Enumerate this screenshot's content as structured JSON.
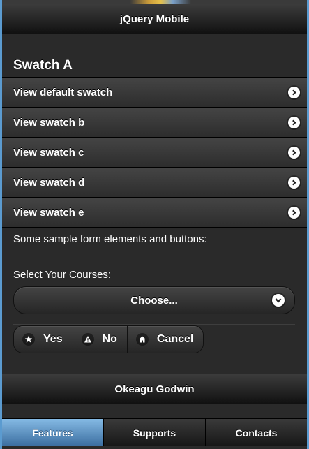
{
  "header": {
    "title": "jQuery Mobile"
  },
  "content": {
    "swatch_title": "Swatch A",
    "list_items": [
      {
        "label": "View default swatch",
        "icon": "chevron-right-icon"
      },
      {
        "label": "View swatch b",
        "icon": "chevron-right-icon"
      },
      {
        "label": "View swatch c",
        "icon": "chevron-right-icon"
      },
      {
        "label": "View swatch d",
        "icon": "chevron-right-icon"
      },
      {
        "label": "View swatch e",
        "icon": "chevron-right-icon"
      }
    ],
    "sample_text": "Some sample form elements and buttons:",
    "select": {
      "label": "Select Your Courses:",
      "value": "Choose..."
    },
    "buttons": [
      {
        "label": "Yes",
        "icon": "star-icon"
      },
      {
        "label": "No",
        "icon": "alert-icon"
      },
      {
        "label": "Cancel",
        "icon": "home-icon"
      }
    ]
  },
  "footer": {
    "title": "Okeagu Godwin"
  },
  "navbar": {
    "tabs": [
      {
        "label": "Features",
        "active": true
      },
      {
        "label": "Supports",
        "active": false
      },
      {
        "label": "Contacts",
        "active": false
      }
    ]
  },
  "colors": {
    "background": "#2a2a2a",
    "active_tab": "#5b9bd0",
    "text": "#ffffff"
  }
}
